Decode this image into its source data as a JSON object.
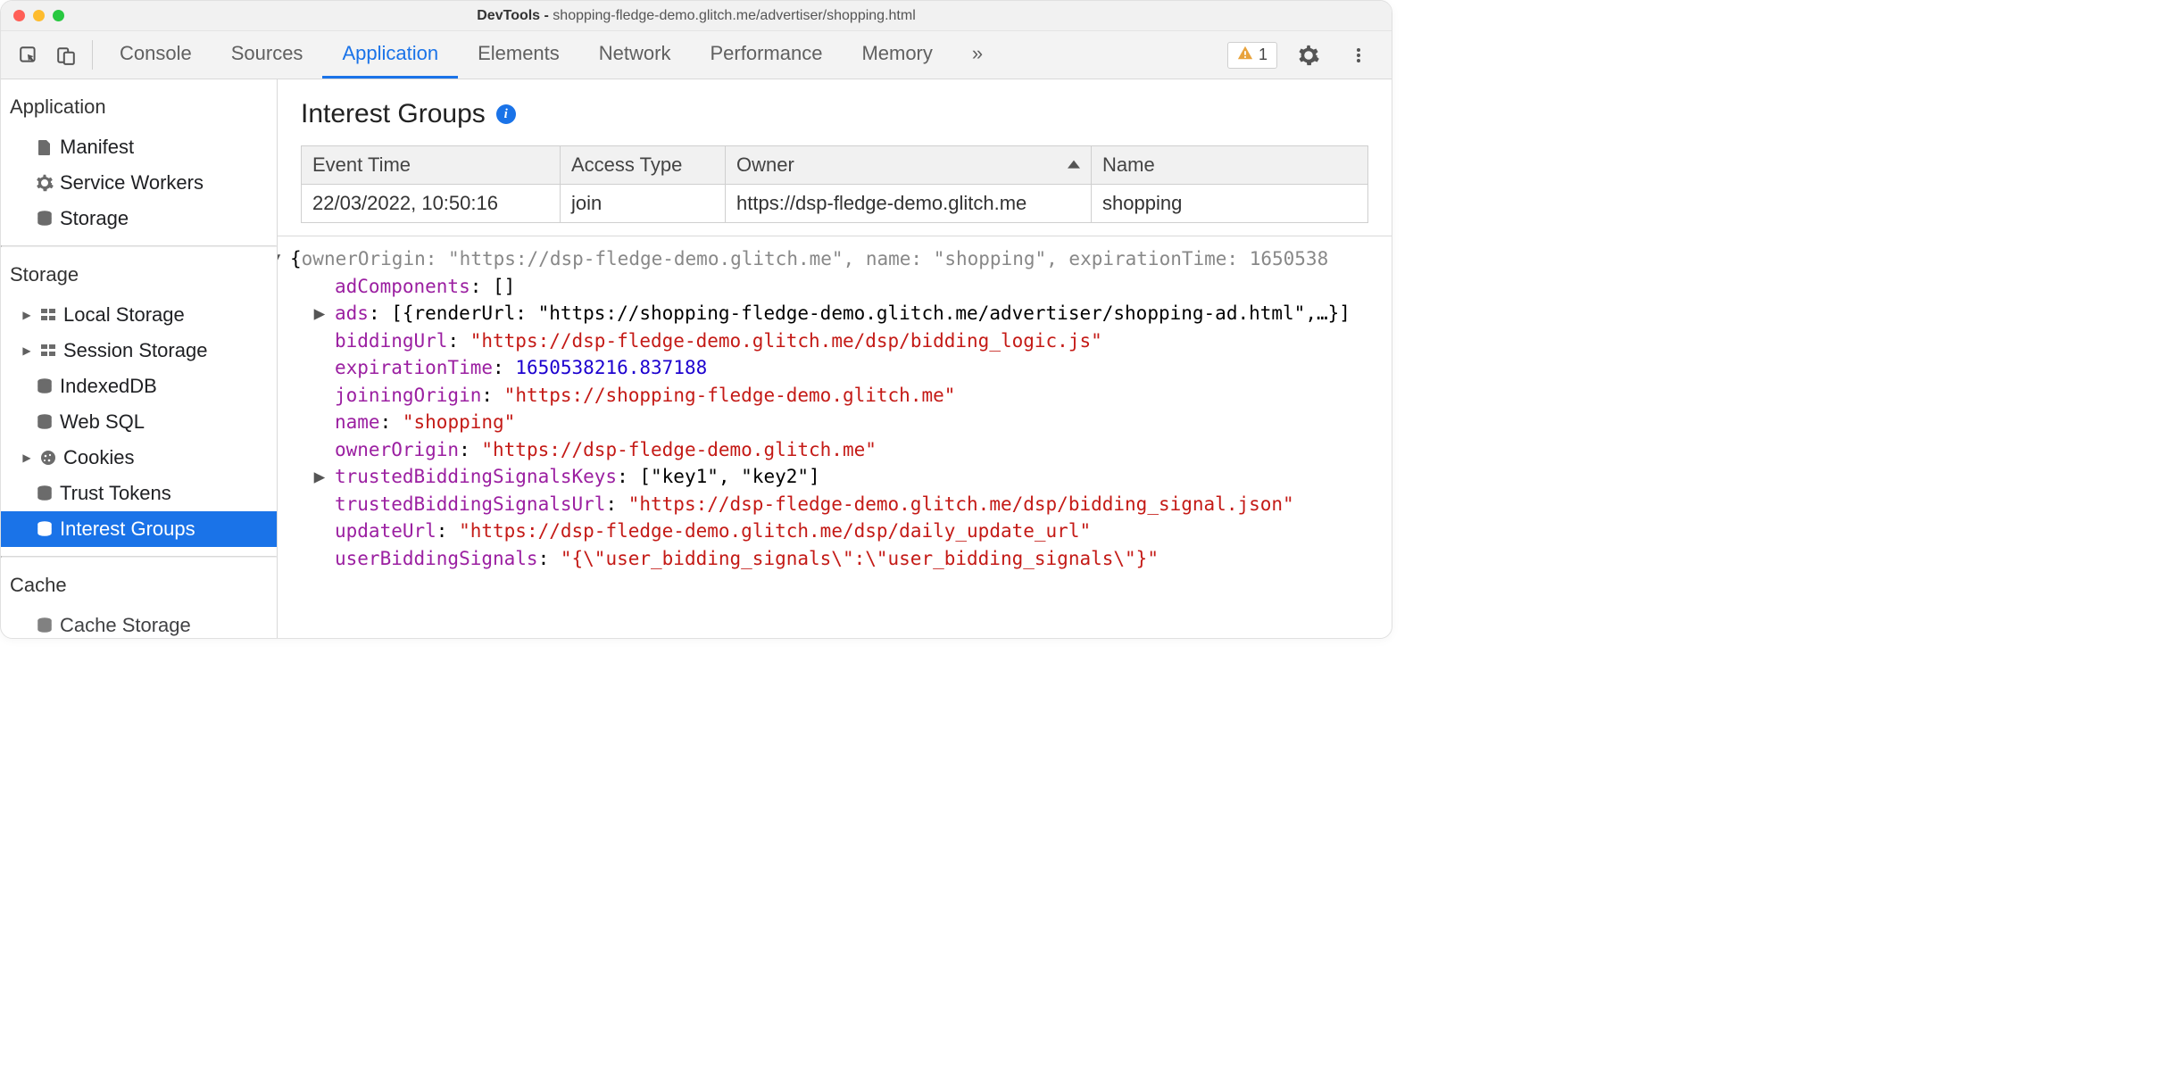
{
  "titlebar": {
    "prefix": "DevTools - ",
    "url": "shopping-fledge-demo.glitch.me/advertiser/shopping.html"
  },
  "tabs": {
    "items": [
      "Console",
      "Sources",
      "Application",
      "Elements",
      "Network",
      "Performance",
      "Memory"
    ],
    "active": "Application",
    "overflow": "»"
  },
  "warnings_count": "1",
  "sidebar": {
    "sections": [
      {
        "title": "Application",
        "items": [
          {
            "icon": "file-icon",
            "label": "Manifest",
            "caret": false
          },
          {
            "icon": "gear-icon",
            "label": "Service Workers",
            "caret": false
          },
          {
            "icon": "storage-icon",
            "label": "Storage",
            "caret": false
          }
        ]
      },
      {
        "title": "Storage",
        "items": [
          {
            "icon": "grid-icon",
            "label": "Local Storage",
            "caret": true
          },
          {
            "icon": "grid-icon",
            "label": "Session Storage",
            "caret": true
          },
          {
            "icon": "storage-icon",
            "label": "IndexedDB",
            "caret": false
          },
          {
            "icon": "storage-icon",
            "label": "Web SQL",
            "caret": false
          },
          {
            "icon": "cookie-icon",
            "label": "Cookies",
            "caret": true
          },
          {
            "icon": "storage-icon",
            "label": "Trust Tokens",
            "caret": false
          },
          {
            "icon": "storage-icon",
            "label": "Interest Groups",
            "caret": false,
            "selected": true
          }
        ]
      },
      {
        "title": "Cache",
        "items": [
          {
            "icon": "storage-icon",
            "label": "Cache Storage",
            "caret": false
          }
        ]
      }
    ]
  },
  "panel": {
    "title": "Interest Groups",
    "table": {
      "columns": [
        "Event Time",
        "Access Type",
        "Owner",
        "Name"
      ],
      "sort_column": "Owner",
      "rows": [
        {
          "event_time": "22/03/2022, 10:50:16",
          "access_type": "join",
          "owner": "https://dsp-fledge-demo.glitch.me",
          "name": "shopping"
        }
      ]
    },
    "detail": {
      "root_summary_parts": {
        "ownerOrigin": "\"https://dsp-fledge-demo.glitch.me\"",
        "name": "\"shopping\"",
        "expirationTime_trunc": "1650538"
      },
      "props": {
        "adComponents": "[]",
        "ads_summary": "[{renderUrl: \"https://shopping-fledge-demo.glitch.me/advertiser/shopping-ad.html\",…}]",
        "biddingUrl": "\"https://dsp-fledge-demo.glitch.me/dsp/bidding_logic.js\"",
        "expirationTime": "1650538216.837188",
        "joiningOrigin": "\"https://shopping-fledge-demo.glitch.me\"",
        "name": "\"shopping\"",
        "ownerOrigin": "\"https://dsp-fledge-demo.glitch.me\"",
        "trustedBiddingSignalsKeys": "[\"key1\", \"key2\"]",
        "trustedBiddingSignalsUrl": "\"https://dsp-fledge-demo.glitch.me/dsp/bidding_signal.json\"",
        "updateUrl": "\"https://dsp-fledge-demo.glitch.me/dsp/daily_update_url\"",
        "userBiddingSignals": "\"{\\\"user_bidding_signals\\\":\\\"user_bidding_signals\\\"}\""
      }
    }
  }
}
